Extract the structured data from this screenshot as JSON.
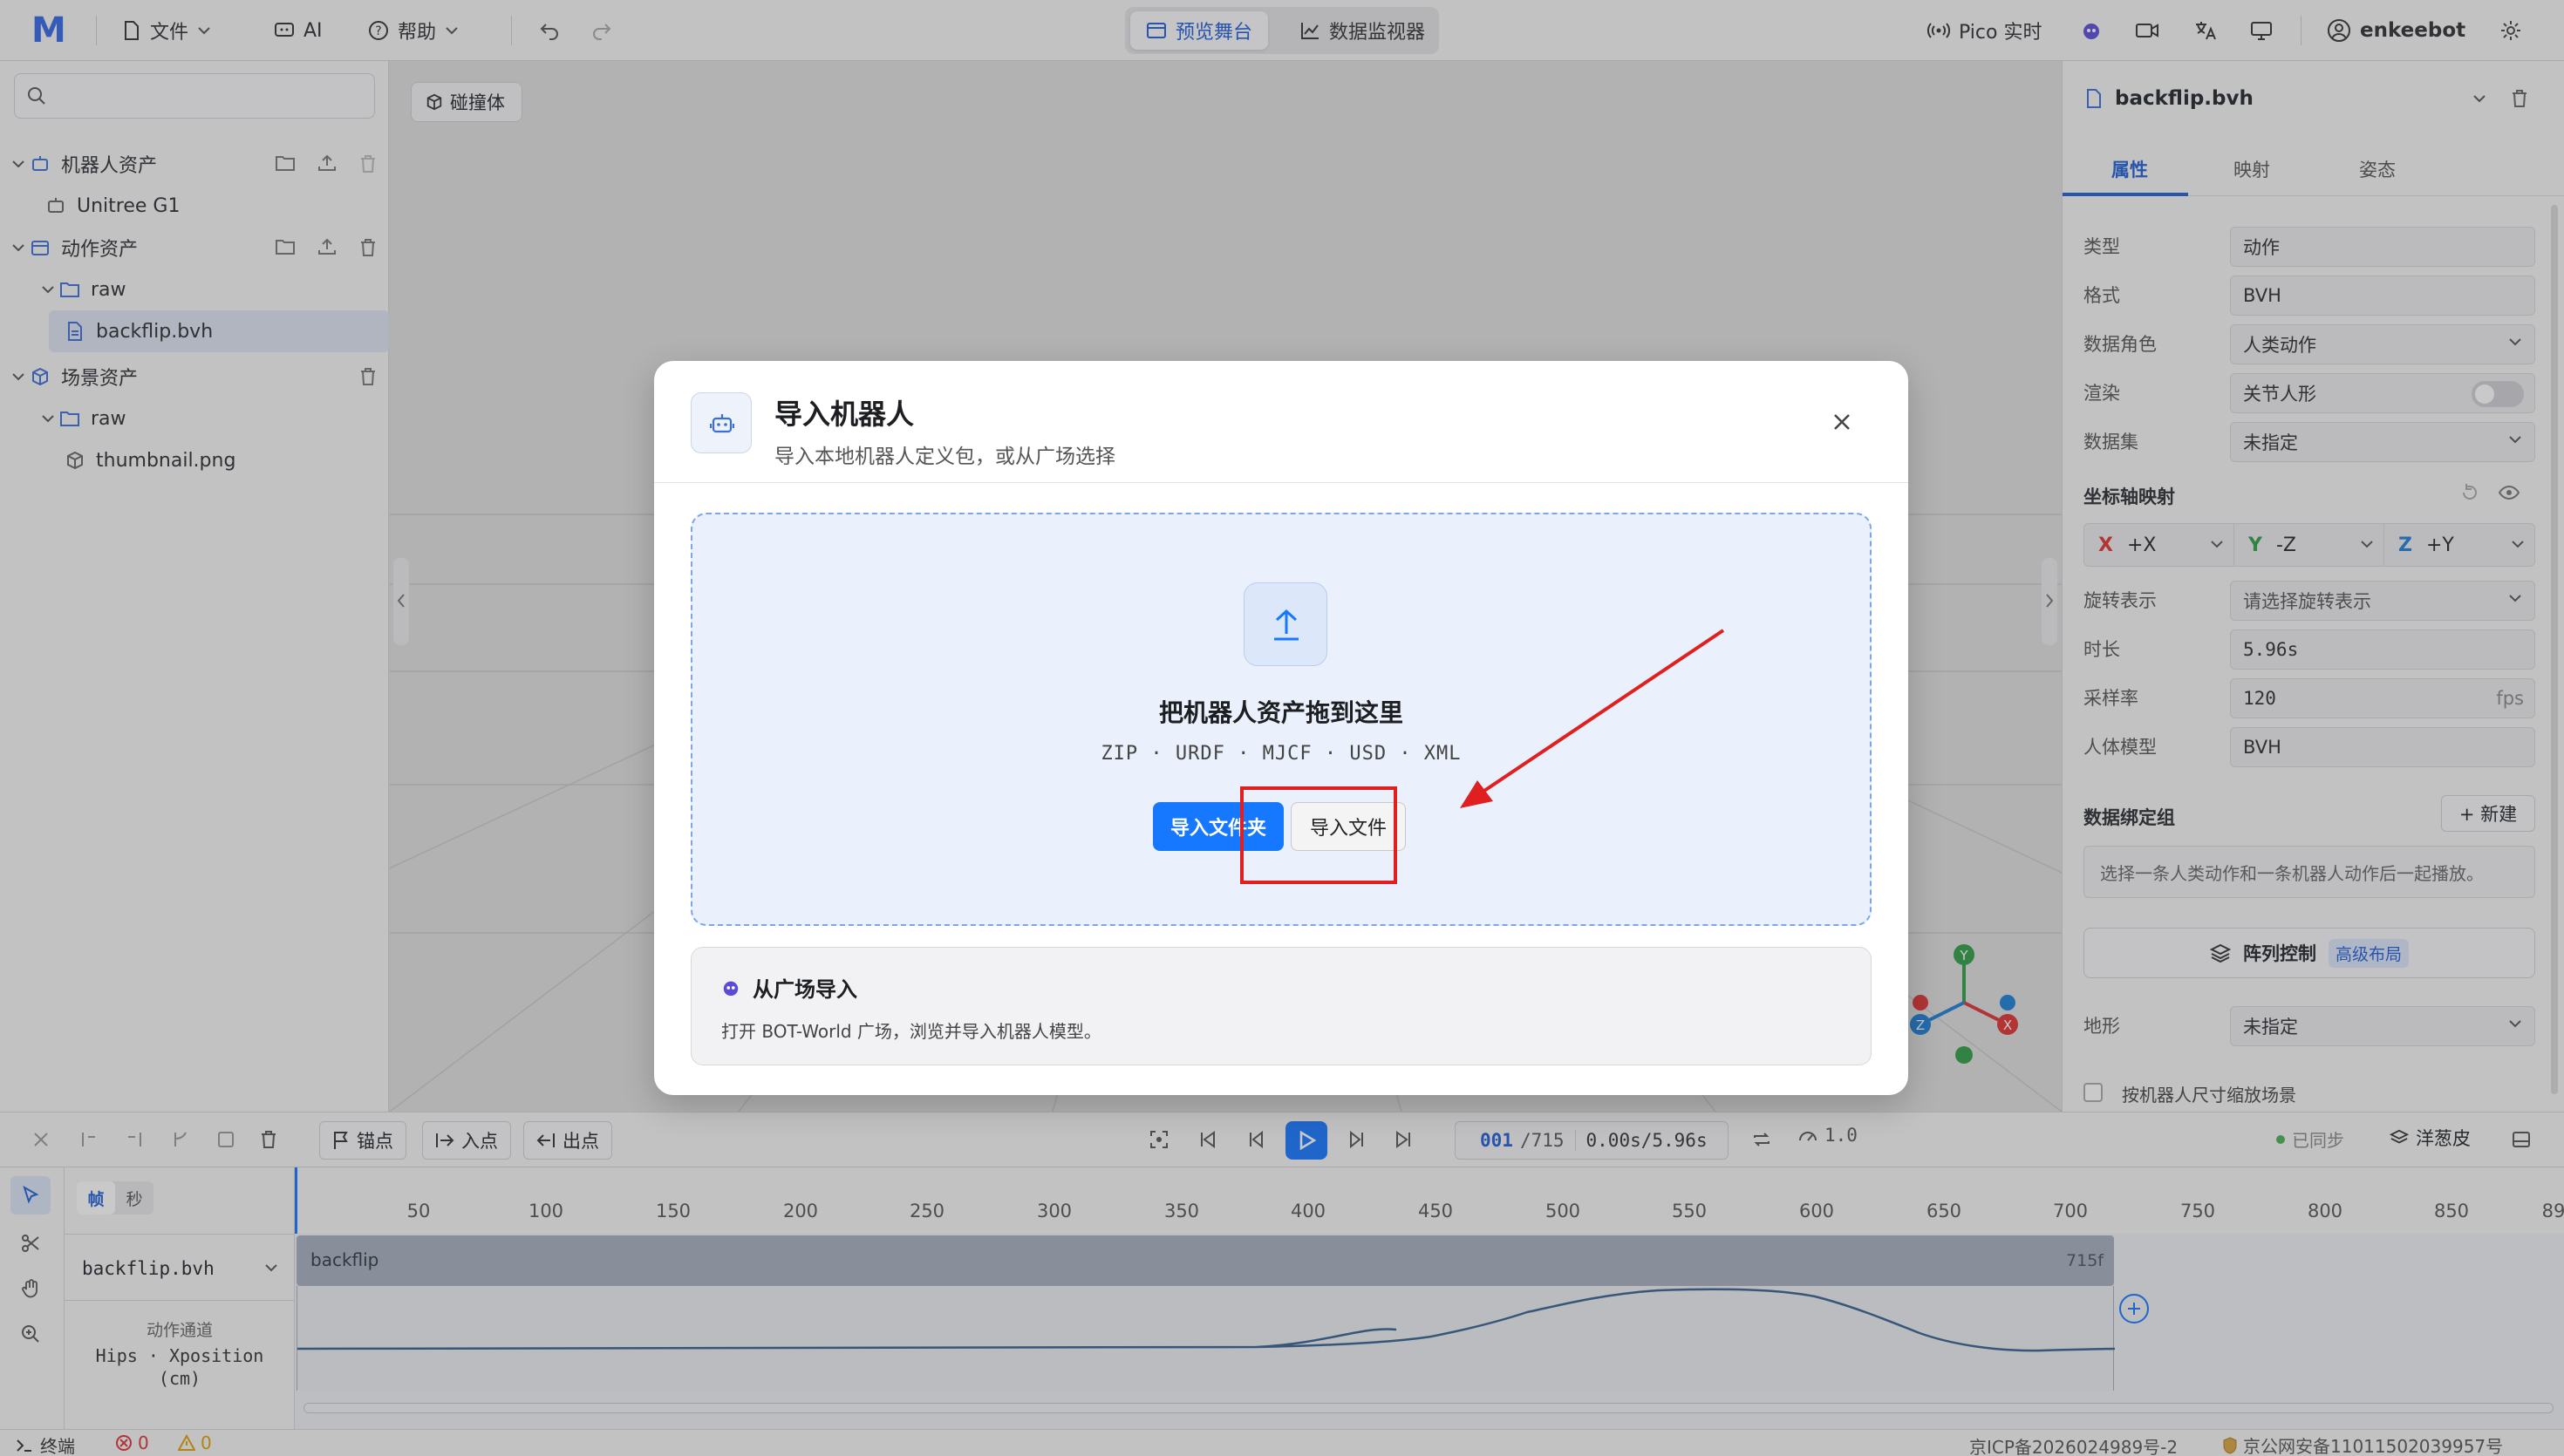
{
  "topbar": {
    "logo": "M",
    "menu_file": "文件",
    "menu_ai": "AI",
    "menu_help": "帮助",
    "tab_preview": "预览舞台",
    "tab_monitor": "数据监视器",
    "pico": "Pico 实时",
    "username": "enkeebot"
  },
  "left_panel": {
    "search_placeholder": "",
    "groups": [
      {
        "label": "机器人资产",
        "children": [
          "Unitree G1"
        ]
      },
      {
        "label": "动作资产",
        "folder": "raw",
        "file": "backflip.bvh"
      },
      {
        "label": "场景资产",
        "folder": "raw",
        "file": "thumbnail.png"
      }
    ]
  },
  "viewport": {
    "collision_button": "碰撞体"
  },
  "right_panel": {
    "file_name": "backflip.bvh",
    "tabs": [
      "属性",
      "映射",
      "姿态"
    ],
    "active_tab": "属性",
    "props": [
      {
        "label": "类型",
        "value": "动作"
      },
      {
        "label": "格式",
        "value": "BVH"
      },
      {
        "label": "数据角色",
        "value": "人类动作"
      },
      {
        "label": "渲染",
        "value": "关节人形"
      },
      {
        "label": "数据集",
        "value": "未指定"
      }
    ],
    "axis_section": "坐标轴映射",
    "axes": [
      {
        "axis": "X",
        "value": "+X",
        "color": "#e03131"
      },
      {
        "axis": "Y",
        "value": "-Z",
        "color": "#2f9e44"
      },
      {
        "axis": "Z",
        "value": "+Y",
        "color": "#1c7ed6"
      }
    ],
    "props2": [
      {
        "label": "旋转表示",
        "value": "请选择旋转表示"
      },
      {
        "label": "时长",
        "value": "5.96s"
      },
      {
        "label": "采样率",
        "value": "120",
        "unit": "fps"
      },
      {
        "label": "人体模型",
        "value": "BVH"
      }
    ],
    "binding_section": "数据绑定组",
    "new_button": "+ 新建",
    "binding_hint": "选择一条人类动作和一条机器人动作后一起播放。",
    "array_button": "阵列控制",
    "array_badge": "高级布局",
    "terrain_label": "地形",
    "terrain_value": "未指定",
    "scale_checkbox": "按机器人尺寸缩放场景"
  },
  "bottom_toolbar": {
    "anchor": "锚点",
    "in_point": "入点",
    "out_point": "出点",
    "frame_current": "001",
    "frame_total": "/715",
    "time_display": "0.00s/5.96s",
    "speed": "1.0",
    "synced": "已同步",
    "onion": "洋葱皮"
  },
  "timeline": {
    "unit_frame": "帧",
    "unit_second": "秒",
    "ticks": [
      "50",
      "100",
      "150",
      "200",
      "250",
      "300",
      "350",
      "400",
      "450",
      "500",
      "550",
      "600",
      "650",
      "700",
      "750",
      "800",
      "850",
      "89"
    ],
    "track_select": "backflip.bvh",
    "channel_title": "动作通道",
    "channel_name": "Hips · Xposition",
    "channel_unit": "(cm)",
    "clip_label": "backflip",
    "clip_end": "715f"
  },
  "statusbar": {
    "terminal": "终端",
    "errors": "0",
    "warnings": "0",
    "icp": "京ICP备2026024989号-2",
    "police": "京公网安备11011502039957号"
  },
  "modal": {
    "title": "导入机器人",
    "subtitle": "导入本地机器人定义包，或从广场选择",
    "drop_title": "把机器人资产拖到这里",
    "formats": "ZIP · URDF · MJCF · USD · XML",
    "btn_folder": "导入文件夹",
    "btn_file": "导入文件",
    "plaza_title": "从广场导入",
    "plaza_desc": "打开 BOT-World 广场，浏览并导入机器人模型。"
  },
  "colors": {
    "accent": "#1677ff",
    "annotation": "#e02020",
    "brand_purple": "#5b4bd8"
  }
}
